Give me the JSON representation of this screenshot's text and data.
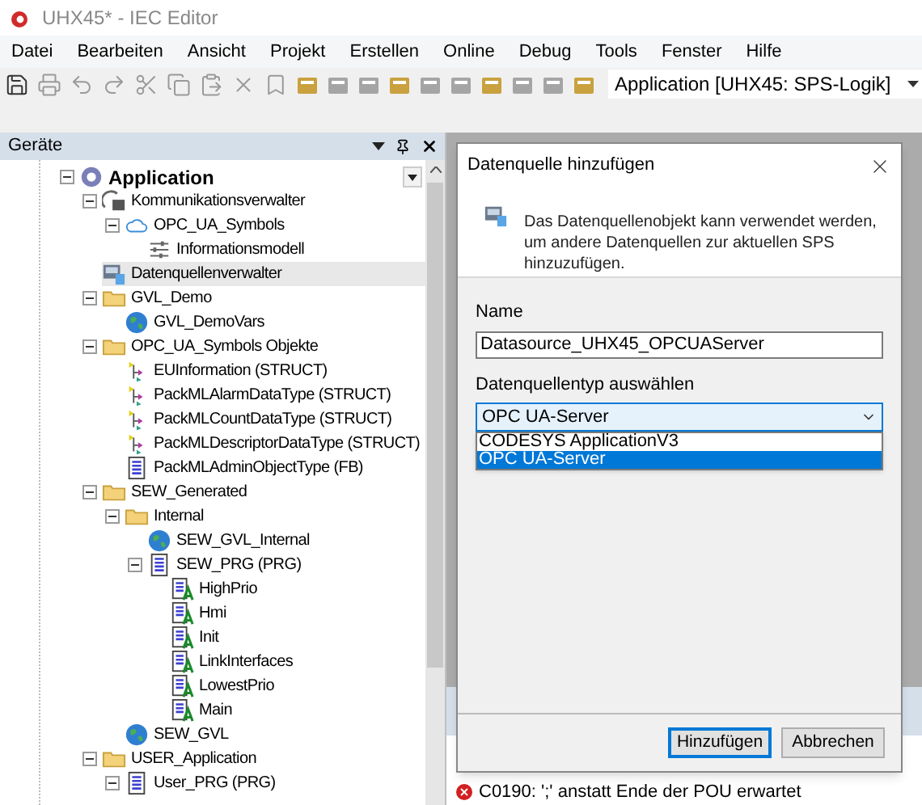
{
  "window": {
    "title": "UHX45* - IEC Editor"
  },
  "menu": [
    "Datei",
    "Bearbeiten",
    "Ansicht",
    "Projekt",
    "Erstellen",
    "Online",
    "Debug",
    "Tools",
    "Fenster",
    "Hilfe"
  ],
  "toolbar": {
    "application": "Application [UHX45: SPS-Logik]"
  },
  "devices_panel": {
    "title": "Geräte",
    "tree": [
      {
        "label": "Application",
        "kind": "application",
        "expanded": true,
        "selected": false,
        "children": [
          {
            "label": "Kommunikationsverwalter",
            "kind": "manager",
            "expanded": true,
            "selected": false,
            "children": [
              {
                "label": "OPC_UA_Symbols",
                "kind": "cloud",
                "expanded": true,
                "selected": false,
                "children": [
                  {
                    "label": "Informationsmodell",
                    "kind": "model",
                    "selected": false
                  }
                ]
              }
            ]
          },
          {
            "label": "Datenquellenverwalter",
            "kind": "datasource",
            "selected": true
          },
          {
            "label": "GVL_Demo",
            "kind": "folder",
            "expanded": true,
            "selected": false,
            "children": [
              {
                "label": "GVL_DemoVars",
                "kind": "gvl",
                "selected": false
              }
            ]
          },
          {
            "label": "OPC_UA_Symbols Objekte",
            "kind": "folder",
            "expanded": true,
            "selected": false,
            "children": [
              {
                "label": "EUInformation (STRUCT)",
                "kind": "struct",
                "selected": false
              },
              {
                "label": "PackMLAlarmDataType (STRUCT)",
                "kind": "struct",
                "selected": false
              },
              {
                "label": "PackMLCountDataType (STRUCT)",
                "kind": "struct",
                "selected": false
              },
              {
                "label": "PackMLDescriptorDataType (STRUCT)",
                "kind": "struct",
                "selected": false
              },
              {
                "label": "PackMLAdminObjectType (FB)",
                "kind": "pou",
                "selected": false
              }
            ]
          },
          {
            "label": "SEW_Generated",
            "kind": "folder",
            "expanded": true,
            "selected": false,
            "children": [
              {
                "label": "Internal",
                "kind": "folder",
                "expanded": true,
                "selected": false,
                "children": [
                  {
                    "label": "SEW_GVL_Internal",
                    "kind": "gvl",
                    "selected": false
                  },
                  {
                    "label": "SEW_PRG (PRG)",
                    "kind": "pou",
                    "expanded": true,
                    "selected": false,
                    "children": [
                      {
                        "label": "HighPrio",
                        "kind": "action",
                        "selected": false
                      },
                      {
                        "label": "Hmi",
                        "kind": "action",
                        "selected": false
                      },
                      {
                        "label": "Init",
                        "kind": "action",
                        "selected": false
                      },
                      {
                        "label": "LinkInterfaces",
                        "kind": "action",
                        "selected": false
                      },
                      {
                        "label": "LowestPrio",
                        "kind": "action",
                        "selected": false
                      },
                      {
                        "label": "Main",
                        "kind": "action",
                        "selected": false
                      }
                    ]
                  }
                ]
              },
              {
                "label": "SEW_GVL",
                "kind": "gvl",
                "selected": false
              }
            ]
          },
          {
            "label": "USER_Application",
            "kind": "folder",
            "expanded": true,
            "selected": false,
            "children": [
              {
                "label": "User_PRG (PRG)",
                "kind": "pou",
                "expanded": true,
                "selected": false
              }
            ]
          }
        ]
      }
    ]
  },
  "dialog": {
    "title": "Datenquelle hinzufügen",
    "description": "Das Datenquellenobjekt kann verwendet werden, um andere Datenquellen zur aktuellen SPS hinzuzufügen.",
    "name_label": "Name",
    "name_value": "Datasource_UHX45_OPCUAServer",
    "type_label": "Datenquellentyp auswählen",
    "type_value": "OPC UA-Server",
    "type_options": [
      {
        "label": "CODESYS ApplicationV3",
        "selected": false
      },
      {
        "label": "OPC UA-Server",
        "selected": true
      }
    ],
    "buttons": [
      {
        "label": "Hinzufügen",
        "default": true
      },
      {
        "label": "Abbrechen",
        "default": false
      }
    ]
  },
  "messages": [
    {
      "kind": "error",
      "text": "C0190: ';' anstatt Ende der POU erwartet"
    }
  ]
}
